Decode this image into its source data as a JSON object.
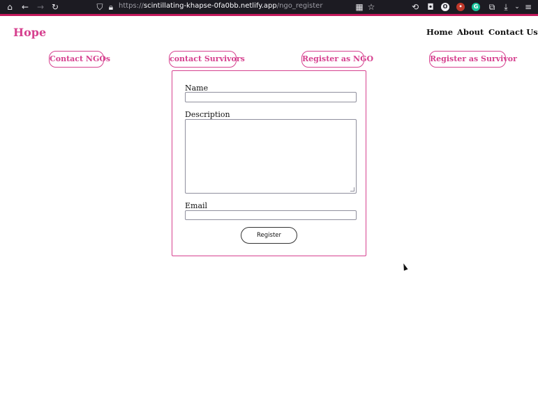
{
  "browser": {
    "url_prefix": "https://",
    "url_domain": "scintillating-khapse-0fa0bb.netlify.app",
    "url_path": "/ngo_register",
    "accent_color": "#c2185b"
  },
  "site": {
    "brand": "Hope",
    "nav": [
      "Home",
      "About",
      "Contact Us"
    ],
    "actions": [
      "Contact NGOs",
      "contact Survivors",
      "Register as NGO",
      "Register as Survivor"
    ],
    "accent_color": "#d6418f"
  },
  "form": {
    "name_label": "Name",
    "name_value": "",
    "description_label": "Description",
    "description_value": "",
    "email_label": "Email",
    "email_value": "",
    "submit_label": "Register"
  }
}
